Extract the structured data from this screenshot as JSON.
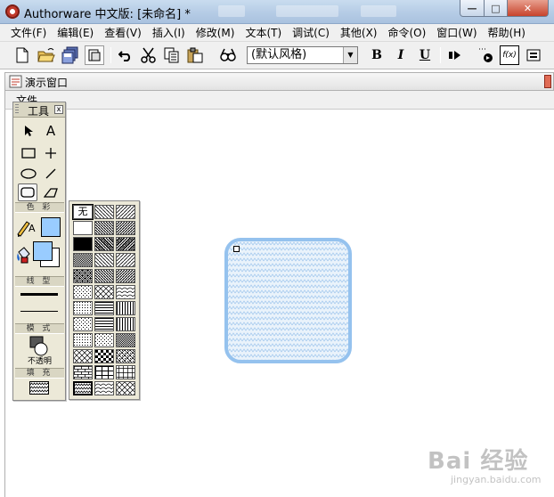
{
  "window": {
    "title": "Authorware 中文版: [未命名] *",
    "controls": {
      "minimize": "—",
      "maximize": "□",
      "close": "✕"
    }
  },
  "menubar": {
    "items": [
      "文件(F)",
      "编辑(E)",
      "查看(V)",
      "插入(I)",
      "修改(M)",
      "文本(T)",
      "调试(C)",
      "其他(X)",
      "命令(O)",
      "窗口(W)",
      "帮助(H)"
    ]
  },
  "toolbar": {
    "style_value": "(默认风格)",
    "buttons": [
      "new-icon",
      "open-icon",
      "save-all-icon",
      "import-icon",
      "undo-icon",
      "cut-icon",
      "copy-icon",
      "paste-icon",
      "find-icon",
      "bold",
      "italic",
      "underline",
      "run-icon",
      "control-panel-icon",
      "function-icon",
      "variable-icon"
    ],
    "bold_label": "B",
    "italic_label": "I",
    "underline_label": "U"
  },
  "presentation_window": {
    "title": "演示窗口",
    "menu_label": "文件"
  },
  "tools_panel": {
    "title": "工具",
    "close_label": "x",
    "text_tool_label": "A",
    "section_color": "色 彩",
    "section_line": "线 型",
    "section_mode": "模 式",
    "mode_value": "不透明",
    "section_fill": "填 充",
    "text_color_label": "A",
    "colors": {
      "pen": "#000000",
      "fill": "#99ccff",
      "panel": "#ece9d8"
    }
  },
  "fill_palette": {
    "none_label": "无",
    "selected_index": 0
  },
  "canvas": {
    "shape": "rounded-rectangle",
    "shape_fill": "#99ccff",
    "shape_pattern": "wave"
  },
  "watermark": {
    "logo": "Bai 经验",
    "url": "jingyan.baidu.com"
  }
}
